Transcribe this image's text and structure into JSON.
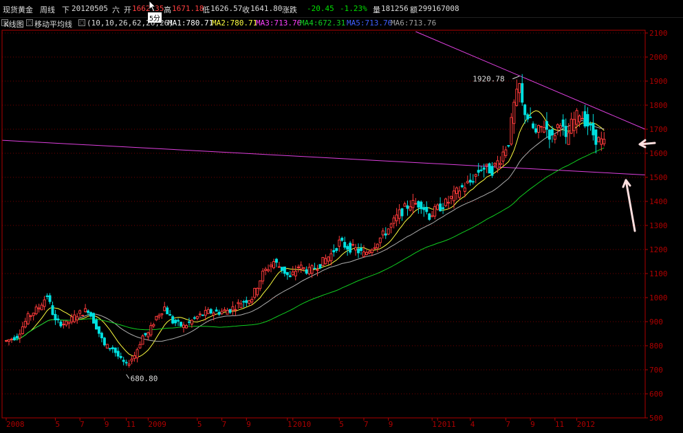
{
  "header": {
    "instrument": "现货黄金",
    "period": "周线",
    "direction": "下",
    "date": "20120505",
    "weekday": "六",
    "open_label": "开",
    "open_value": "1662.35",
    "high_label": "高",
    "high_value": "1671.18",
    "low_label": "低",
    "low_value": "1626.57",
    "close_label": "收",
    "close_value": "1641.80",
    "change_label": "涨跌",
    "change_value": "-20.45",
    "change_pct": "-1.23%",
    "volume_label": "量",
    "volume_value": "181256",
    "amount_label": "额",
    "amount_value": "299167008"
  },
  "tooltip": "5分",
  "indicator_bar": {
    "kline_label": "K线图",
    "ma_label": "移动平均线",
    "ma_params": "(10,10,26,62,26,26)",
    "ma1": "MA1:780.71",
    "ma2": "MA2:780.71",
    "ma3": "MA3:713.76",
    "ma4": "MA4:672.31",
    "ma5": "MA5:713.76",
    "ma6": "MA6:713.76"
  },
  "colors": {
    "background": "#000000",
    "up": "#ff3b3b",
    "down": "#00e0e0",
    "ma_yellow": "#ffff40",
    "ma_gray": "#b0b0b0",
    "ma_green": "#10d020",
    "trendline": "#e040e0",
    "axis": "#b00000",
    "grid": "#7a0000",
    "arrow": "#ffe0e0"
  },
  "chart_data": {
    "type": "candlestick",
    "ylim": [
      500,
      2100
    ],
    "y_ticks": [
      500,
      600,
      700,
      800,
      900,
      1000,
      1100,
      1200,
      1300,
      1400,
      1500,
      1600,
      1700,
      1800,
      1900,
      2000,
      2100
    ],
    "x_ticks": [
      {
        "label": "2008",
        "week": 0
      },
      {
        "label": "5",
        "week": 18
      },
      {
        "label": "7",
        "week": 27
      },
      {
        "label": "9",
        "week": 36
      },
      {
        "label": "11",
        "week": 44
      },
      {
        "label": "2009",
        "week": 52
      },
      {
        "label": "5",
        "week": 70
      },
      {
        "label": "7",
        "week": 79
      },
      {
        "label": "9",
        "week": 88
      },
      {
        "label": "1",
        "week": 103
      },
      {
        "label": "2010",
        "week": 105
      },
      {
        "label": "5",
        "week": 122
      },
      {
        "label": "7",
        "week": 131
      },
      {
        "label": "9",
        "week": 140
      },
      {
        "label": "1",
        "week": 156
      },
      {
        "label": "2011",
        "week": 158
      },
      {
        "label": "4",
        "week": 170
      },
      {
        "label": "7",
        "week": 183
      },
      {
        "label": "9",
        "week": 192
      },
      {
        "label": "11",
        "week": 201
      },
      {
        "label": "2012",
        "week": 209
      }
    ],
    "weekly_close": [
      [
        0,
        820
      ],
      [
        4,
        840
      ],
      [
        8,
        920
      ],
      [
        12,
        960
      ],
      [
        15,
        1010
      ],
      [
        18,
        900
      ],
      [
        22,
        890
      ],
      [
        26,
        930
      ],
      [
        30,
        950
      ],
      [
        33,
        880
      ],
      [
        36,
        800
      ],
      [
        39,
        790
      ],
      [
        42,
        740
      ],
      [
        44,
        720
      ],
      [
        47,
        760
      ],
      [
        50,
        840
      ],
      [
        52,
        850
      ],
      [
        55,
        920
      ],
      [
        58,
        960
      ],
      [
        61,
        900
      ],
      [
        65,
        880
      ],
      [
        70,
        920
      ],
      [
        74,
        940
      ],
      [
        78,
        940
      ],
      [
        82,
        950
      ],
      [
        86,
        980
      ],
      [
        90,
        1000
      ],
      [
        94,
        1100
      ],
      [
        98,
        1150
      ],
      [
        101,
        1120
      ],
      [
        104,
        1080
      ],
      [
        107,
        1130
      ],
      [
        111,
        1110
      ],
      [
        115,
        1140
      ],
      [
        119,
        1180
      ],
      [
        122,
        1230
      ],
      [
        125,
        1210
      ],
      [
        128,
        1200
      ],
      [
        131,
        1180
      ],
      [
        134,
        1210
      ],
      [
        138,
        1260
      ],
      [
        141,
        1300
      ],
      [
        144,
        1350
      ],
      [
        148,
        1390
      ],
      [
        152,
        1390
      ],
      [
        155,
        1340
      ],
      [
        158,
        1370
      ],
      [
        162,
        1400
      ],
      [
        166,
        1450
      ],
      [
        170,
        1480
      ],
      [
        174,
        1540
      ],
      [
        178,
        1530
      ],
      [
        181,
        1580
      ],
      [
        184,
        1650
      ],
      [
        186,
        1800
      ],
      [
        188,
        1880
      ],
      [
        189,
        1800
      ],
      [
        191,
        1750
      ],
      [
        194,
        1680
      ],
      [
        197,
        1720
      ],
      [
        200,
        1660
      ],
      [
        203,
        1740
      ],
      [
        205,
        1650
      ],
      [
        207,
        1720
      ],
      [
        210,
        1770
      ],
      [
        213,
        1720
      ],
      [
        216,
        1660
      ],
      [
        219,
        1640
      ]
    ],
    "annotations": [
      {
        "text": "1920.78",
        "week": 188,
        "value": 1920.78
      },
      {
        "text": "680.80",
        "week": 44,
        "value": 680.8
      }
    ]
  }
}
